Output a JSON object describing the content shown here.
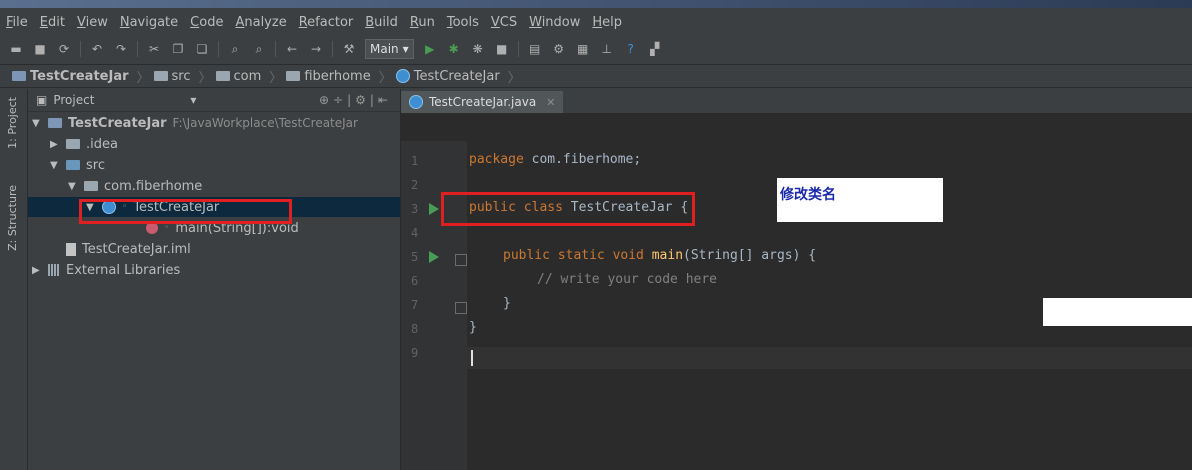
{
  "menu": {
    "items": [
      "File",
      "Edit",
      "View",
      "Navigate",
      "Code",
      "Analyze",
      "Refactor",
      "Build",
      "Run",
      "Tools",
      "VCS",
      "Window",
      "Help"
    ]
  },
  "toolbar": {
    "run_config": "Main"
  },
  "breadcrumb": {
    "items": [
      "TestCreateJar",
      "src",
      "com",
      "fiberhome",
      "TestCreateJar"
    ]
  },
  "sidetabs": {
    "project": "1: Project",
    "structure": "Z: Structure"
  },
  "project_panel": {
    "title": "Project",
    "tree": [
      {
        "label": "TestCreateJar",
        "path": "F:\\JavaWorkplace\\TestCreateJar"
      },
      {
        "label": ".idea"
      },
      {
        "label": "src"
      },
      {
        "label": "com.fiberhome"
      },
      {
        "label": "TestCreateJar"
      },
      {
        "label": "main(String[]):void"
      },
      {
        "label": "TestCreateJar.iml"
      },
      {
        "label": "External Libraries"
      }
    ]
  },
  "editor": {
    "tab": "TestCreateJar.java",
    "line_numbers": [
      "1",
      "2",
      "3",
      "4",
      "5",
      "6",
      "7",
      "8",
      "9"
    ],
    "code": {
      "l1_kw": "package",
      "l1_rest": " com.fiberhome;",
      "l3_kw": "public class",
      "l3_rest": " TestCreateJar {",
      "l5_kw": "public static void",
      "l5_fn": "main",
      "l5_rest": "(String[] args) {",
      "l6": "// write your code here",
      "l7": "}",
      "l8": "}"
    }
  },
  "annotation": {
    "label": "修改类名"
  },
  "colors": {
    "annotation_red": "#e02020",
    "keyword": "#cc7832",
    "editor_bg": "#2b2b2b"
  }
}
